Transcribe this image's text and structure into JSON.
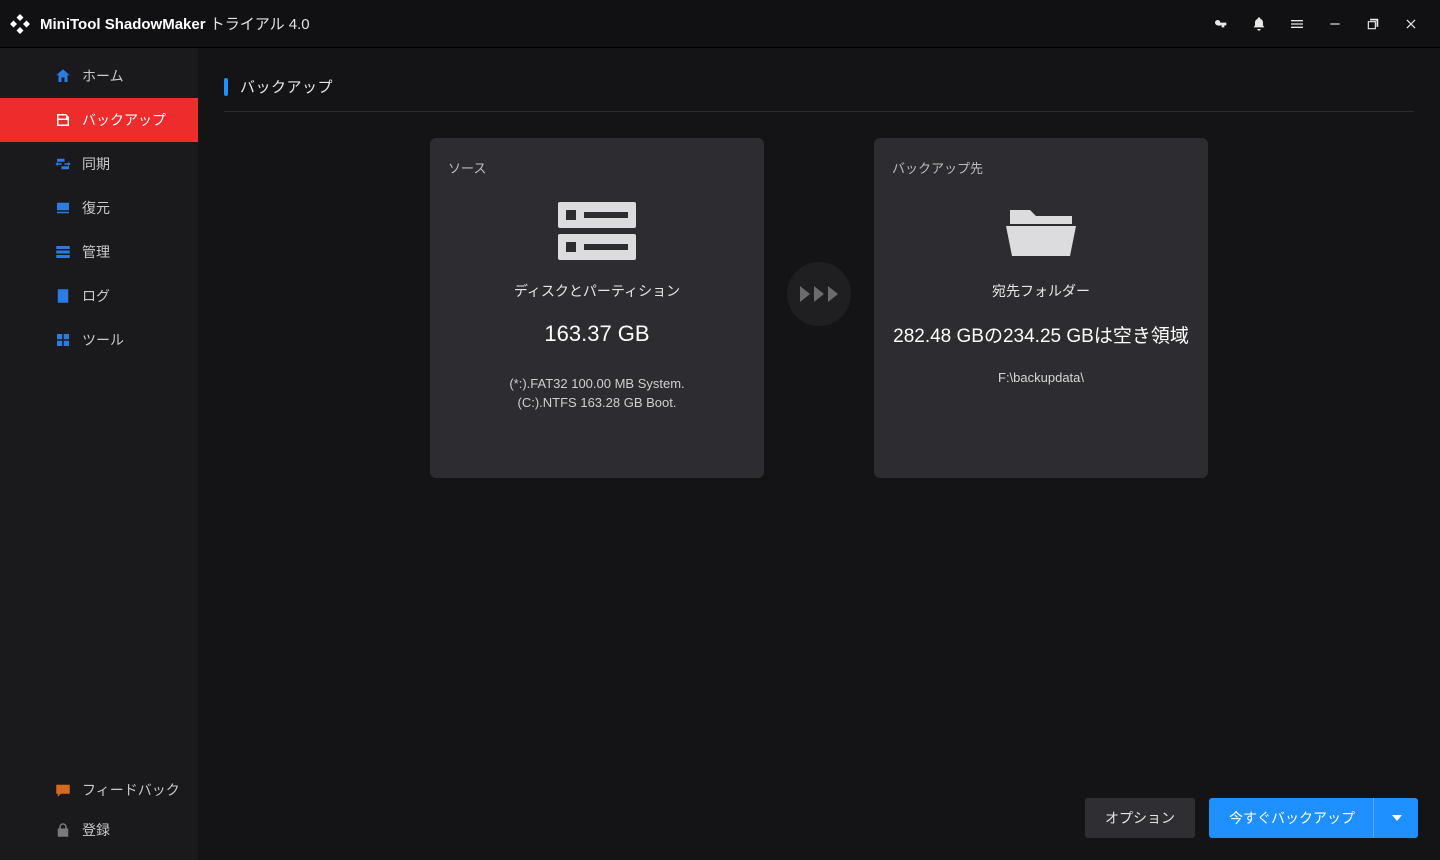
{
  "titlebar": {
    "app_name": "MiniTool ShadowMaker",
    "app_suffix": " トライアル 4.0"
  },
  "sidebar": {
    "items": [
      {
        "icon": "home",
        "label": "ホーム"
      },
      {
        "icon": "backup",
        "label": "バックアップ"
      },
      {
        "icon": "sync",
        "label": "同期"
      },
      {
        "icon": "restore",
        "label": "復元"
      },
      {
        "icon": "manage",
        "label": "管理"
      },
      {
        "icon": "log",
        "label": "ログ"
      },
      {
        "icon": "tools",
        "label": "ツール"
      }
    ],
    "active_index": 1,
    "feedback_label": "フィードバック",
    "register_label": "登録"
  },
  "page": {
    "title": "バックアップ"
  },
  "source_card": {
    "label": "ソース",
    "subtitle": "ディスクとパーティション",
    "size": "163.37 GB",
    "lines": [
      "(*:).FAT32 100.00 MB System.",
      "(C:).NTFS 163.28 GB Boot."
    ]
  },
  "dest_card": {
    "label": "バックアップ先",
    "subtitle": "宛先フォルダー",
    "free_text": "282.48 GBの234.25 GBは空き領域",
    "path": "F:\\backupdata\\"
  },
  "footer": {
    "options_label": "オプション",
    "backup_now_label": "今すぐバックアップ"
  }
}
